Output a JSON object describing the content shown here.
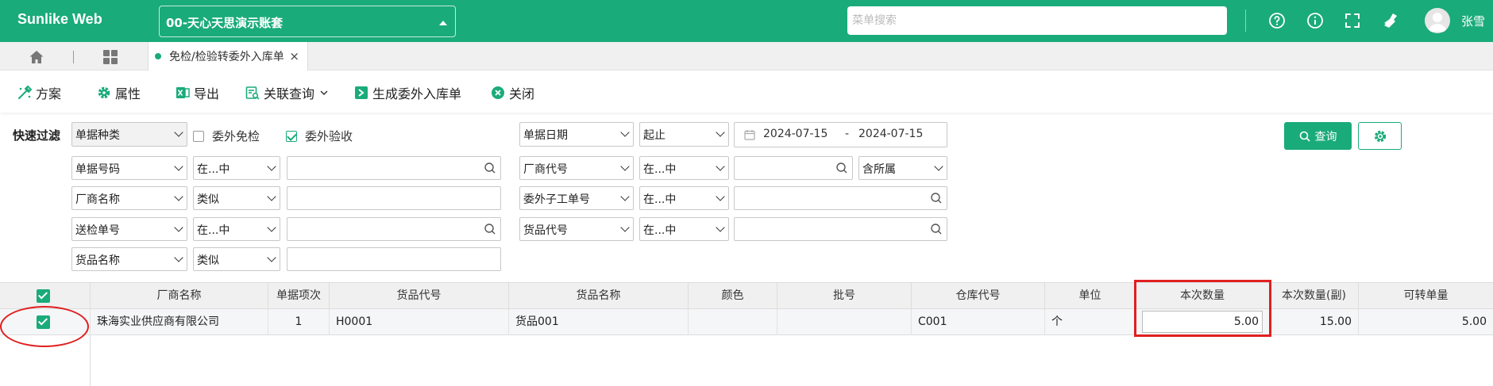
{
  "app": {
    "title": "Sunlike Web",
    "account": "00-天心天思演示账套",
    "menu_search_placeholder": "菜单搜索",
    "username": "张雪",
    "brand_color": "#1aab7a",
    "top_icons": [
      "help-icon",
      "info-icon",
      "fullscreen-icon",
      "clean-icon"
    ]
  },
  "tabs": {
    "home_icon": "home-icon",
    "grid_icon": "apps-grid-icon",
    "active_tab": "免检/检验转委外入库单",
    "close_glyph": "×"
  },
  "toolbar": {
    "items": [
      {
        "label": "方案",
        "icon": "scheme-icon"
      },
      {
        "label": "属性",
        "icon": "gear-icon"
      },
      {
        "label": "导出",
        "icon": "excel-icon"
      },
      {
        "label": "关联查询",
        "icon": "related-query-icon"
      },
      {
        "label": "生成委外入库单",
        "icon": "generate-icon"
      },
      {
        "label": "关闭",
        "icon": "close-circle-icon"
      }
    ]
  },
  "filter": {
    "label": "快速过滤",
    "bill_type": "单据种类",
    "chk_exempt": {
      "label": "委外免检",
      "checked": false
    },
    "chk_accept": {
      "label": "委外验收",
      "checked": true
    },
    "date_field": "单据日期",
    "date_op": "起止",
    "date_from": "2024-07-15",
    "date_sep": "-",
    "date_to": "2024-07-15",
    "query_label": "查询",
    "rows": [
      {
        "field": "单据号码",
        "op": "在...中"
      },
      {
        "field": "厂商名称",
        "op": "类似"
      },
      {
        "field": "送检单号",
        "op": "在...中"
      },
      {
        "field": "货品名称",
        "op": "类似"
      }
    ],
    "rows_right": [
      {
        "field": "厂商代号",
        "op": "在...中",
        "extra": "含所属"
      },
      {
        "field": "委外子工单号",
        "op": "在...中"
      },
      {
        "field": "货品代号",
        "op": "在...中"
      }
    ]
  },
  "grid": {
    "columns": [
      "厂商名称",
      "单据项次",
      "货品代号",
      "货品名称",
      "颜色",
      "批号",
      "仓库代号",
      "单位",
      "本次数量",
      "本次数量(副)",
      "可转单量"
    ],
    "rows": [
      {
        "vendor": "珠海实业供应商有限公司",
        "seq": "1",
        "item_code": "H0001",
        "item_name": "货品001",
        "color": "",
        "batch": "",
        "warehouse": "C001",
        "unit": "个",
        "qty": "5.00",
        "qty_aux": "15.00",
        "convertible": "5.00"
      }
    ]
  },
  "annotation_color": "#e02020"
}
